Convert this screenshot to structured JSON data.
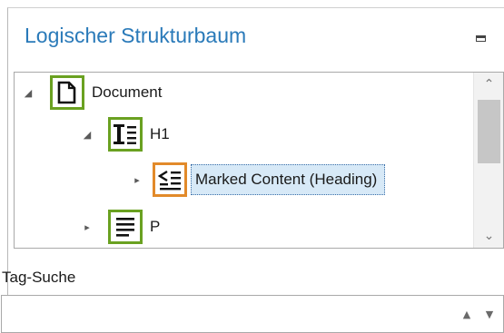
{
  "panel": {
    "title": "Logischer Strukturbaum"
  },
  "tree": {
    "rows": [
      {
        "label": "Document",
        "icon": "document-icon",
        "expanded": true,
        "selected": false
      },
      {
        "label": "H1",
        "icon": "heading-tag-icon",
        "expanded": true,
        "selected": false
      },
      {
        "label": "Marked Content (Heading)",
        "icon": "marked-content-icon",
        "expanded": false,
        "selected": true
      },
      {
        "label": "P",
        "icon": "paragraph-tag-icon",
        "expanded": false,
        "selected": false
      }
    ]
  },
  "tag_search": {
    "label": "Tag-Suche",
    "value": "",
    "placeholder": ""
  },
  "colors": {
    "title": "#2a7ab9",
    "icon_border_green": "#6aa121",
    "icon_border_orange": "#e28a2a",
    "selection_bg": "#d7e9f7"
  }
}
